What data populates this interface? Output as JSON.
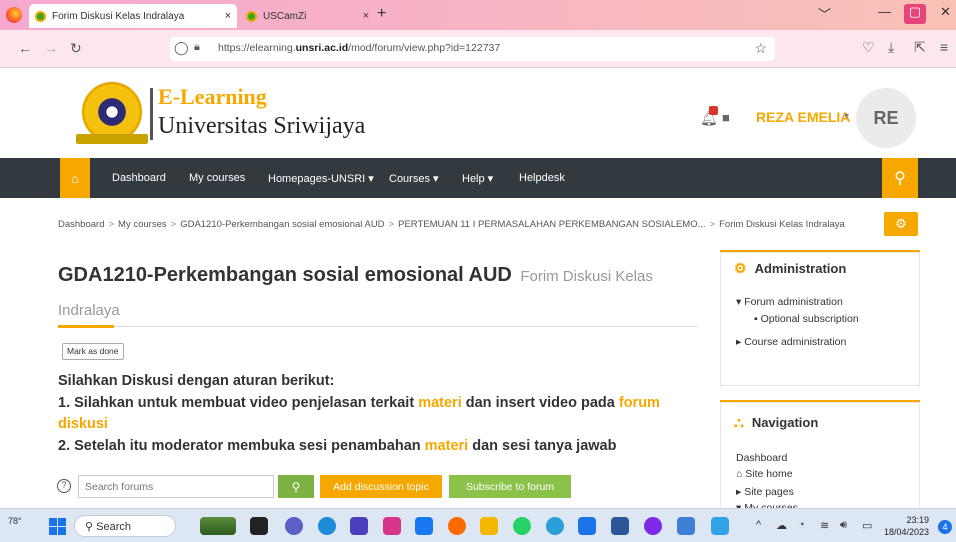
{
  "browser": {
    "tabs": [
      {
        "title": "Forim Diskusi Kelas Indralaya",
        "close": "×"
      },
      {
        "title": "USCamZi",
        "close": "×"
      }
    ],
    "new_tab": "+",
    "url_prefix": "https://elearning.",
    "url_host": "unsri.ac.id",
    "url_path": "/mod/forum/view.php?id=122737"
  },
  "header": {
    "brand_top": "E-Learning",
    "brand_bottom": "Universitas  Sriwijaya",
    "user_name": "REZA EMELIA",
    "avatar_initials": "RE"
  },
  "navbar": {
    "items": [
      "Dashboard",
      "My courses",
      "Homepages-UNSRI ▾",
      "Courses ▾",
      "Help ▾",
      "Helpdesk"
    ]
  },
  "breadcrumb": [
    "Dashboard",
    "My courses",
    "GDA1210-Perkembangan sosial emosional AUD",
    "PERTEMUAN 11 I PERMASALAHAN PERKEMBANGAN SOSIALEMO...",
    "Forim Diskusi Kelas Indralaya"
  ],
  "main": {
    "course_title": "GDA1210-Perkembangan sosial emosional AUD",
    "forum_title": "Forim Diskusi Kelas Indralaya",
    "mark_done": "Mark as done",
    "line1": "Silahkan Diskusi dengan aturan berikut:",
    "line2_a": "1. Silahkan untuk membuat video penjelasan terkait ",
    "line2_hl": "materi",
    "line2_b": " dan insert video pada ",
    "line2_hl2": "forum diskusi",
    "line3_a": "2. Setelah itu moderator membuka sesi penambahan ",
    "line3_hl": "materi",
    "line3_b": " dan sesi tanya jawab",
    "search_placeholder": "Search forums",
    "add_topic": "Add discussion topic",
    "subscribe": "Subscribe to forum"
  },
  "admin_block": {
    "title": "Administration",
    "items": [
      "Forum administration",
      "Optional subscription",
      "Course administration"
    ]
  },
  "nav_block": {
    "title": "Navigation",
    "items": [
      "Dashboard",
      "Site home",
      "Site pages",
      "My courses"
    ]
  },
  "taskbar": {
    "weather": "78°",
    "search": "Search",
    "time": "23:19",
    "date": "18/04/2023",
    "notif_count": "4"
  }
}
